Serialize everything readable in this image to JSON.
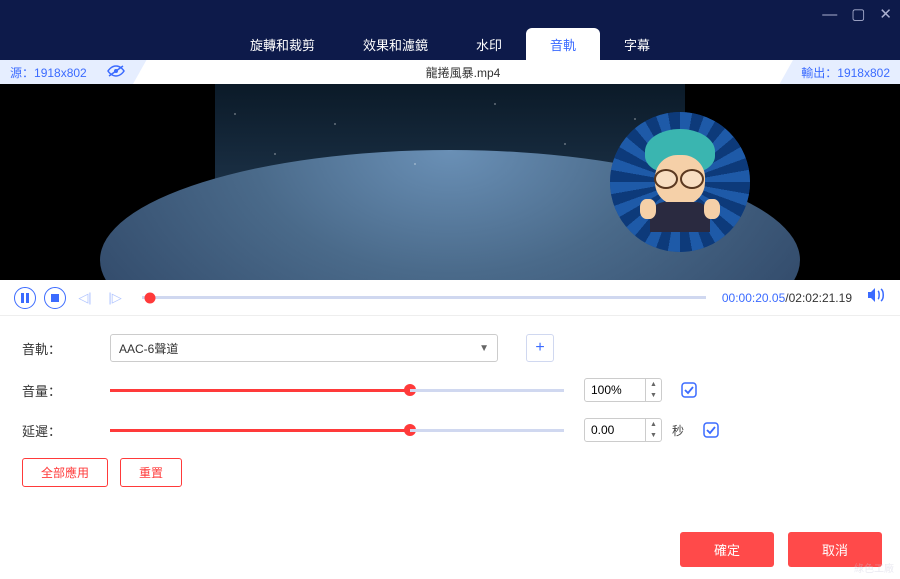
{
  "window": {
    "minimize": "—",
    "maximize": "▢",
    "close": "✕"
  },
  "tabs": {
    "items": [
      {
        "label": "旋轉和裁剪"
      },
      {
        "label": "效果和濾鏡"
      },
      {
        "label": "水印"
      },
      {
        "label": "音軌"
      },
      {
        "label": "字幕"
      }
    ],
    "active_index": 3
  },
  "info": {
    "source_label": "源：",
    "source_value": "1918x802",
    "filename": "龍捲風暴.mp4",
    "output_label": "輸出：",
    "output_value": "1918x802"
  },
  "player": {
    "current_time": "00:00:20.05",
    "total_time": "02:02:21.19"
  },
  "controls": {
    "track": {
      "label": "音軌：",
      "selected": "AAC-6聲道"
    },
    "volume": {
      "label": "音量：",
      "value": "100%"
    },
    "delay": {
      "label": "延遲：",
      "value": "0.00",
      "unit": "秒"
    }
  },
  "actions": {
    "apply_all": "全部應用",
    "reset": "重置"
  },
  "footer": {
    "ok": "確定",
    "cancel": "取消"
  },
  "watermark": "綠色工廠"
}
